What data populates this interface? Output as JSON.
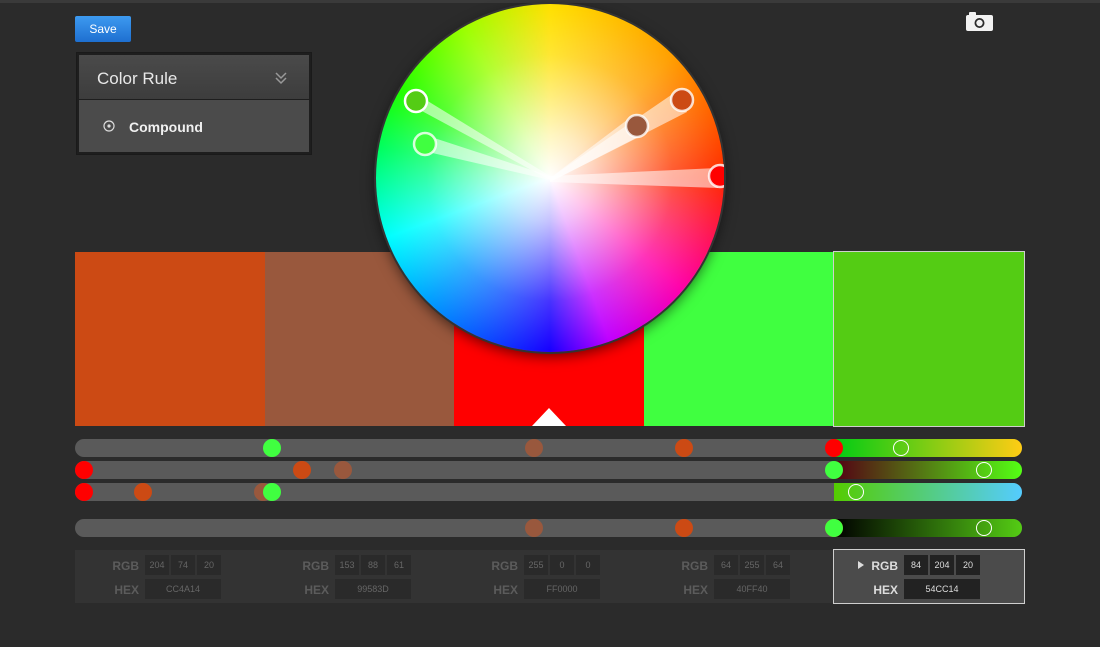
{
  "toolbar": {
    "save_label": "Save"
  },
  "color_rule": {
    "title": "Color Rule",
    "option": "Compound"
  },
  "swatches": [
    {
      "hex": "#CC4A14",
      "rgb": [
        "204",
        "74",
        "20"
      ],
      "hex_label": "CC4A14"
    },
    {
      "hex": "#99583D",
      "rgb": [
        "153",
        "88",
        "61"
      ],
      "hex_label": "99583D"
    },
    {
      "hex": "#FF0000",
      "rgb": [
        "255",
        "0",
        "0"
      ],
      "hex_label": "FF0000"
    },
    {
      "hex": "#40FF40",
      "rgb": [
        "64",
        "255",
        "64"
      ],
      "hex_label": "40FF40"
    },
    {
      "hex": "#54CC14",
      "rgb": [
        "84",
        "204",
        "20"
      ],
      "hex_label": "54CC14"
    }
  ],
  "selected_swatch": 4,
  "base_swatch": 2,
  "labels": {
    "rgb": "RGB",
    "hex": "HEX"
  },
  "icons": {
    "save": "save-button",
    "camera": "camera-icon",
    "collapse": "double-chevron-down-icon",
    "radio": "radio-icon",
    "caret": "caret-right-icon",
    "base": "triangle-up-icon"
  },
  "colors": {
    "accent": "#2d83e0",
    "background": "#2b2b2b"
  }
}
